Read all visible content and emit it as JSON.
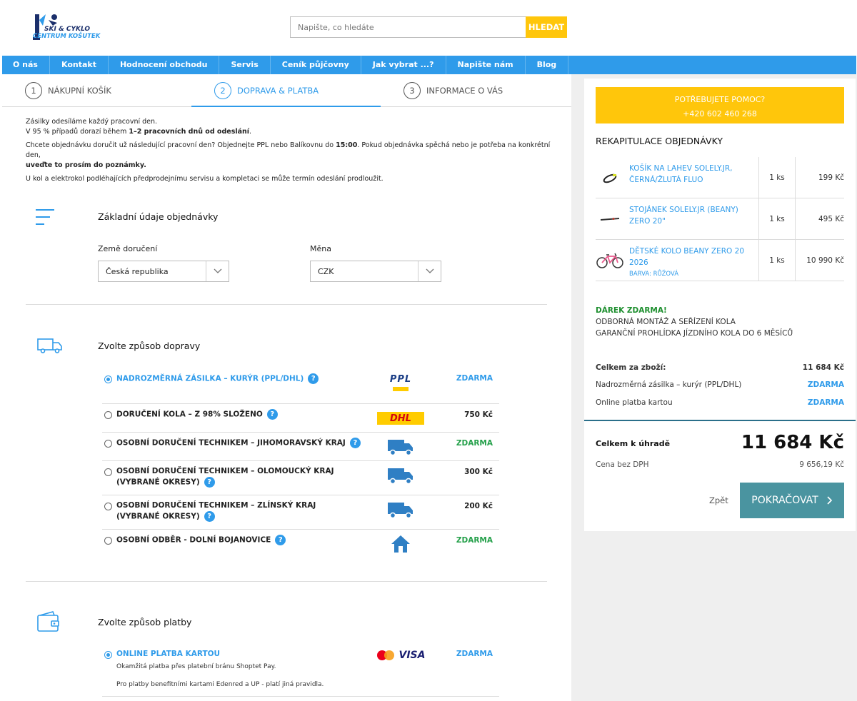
{
  "header": {
    "logo_text_1": "SKI & CYKLO",
    "logo_text_2": "CENTRUM KOŠUTEK",
    "search_placeholder": "Napište, co hledáte",
    "search_button": "HLEDAT"
  },
  "nav": [
    "O nás",
    "Kontakt",
    "Hodnocení obchodu",
    "Servis",
    "Ceník půjčovny",
    "Jak vybrat ...?",
    "Napište nám",
    "Blog"
  ],
  "steps": [
    {
      "num": "1",
      "label": "NÁKUPNÍ KOŠÍK"
    },
    {
      "num": "2",
      "label": "DOPRAVA & PLATBA"
    },
    {
      "num": "3",
      "label": "INFORMACE O VÁS"
    }
  ],
  "info": {
    "l1": "Zásilky odesíláme každý pracovní den.",
    "l2a": "V 95 % případů dorazí během ",
    "l2b": "1–2 pracovních dnů od odeslání",
    "l2c": ".",
    "l3a": "Chcete objednávku doručit už následující pracovní den? Objednejte PPL nebo Balíkovnu do ",
    "l3b": "15:00",
    "l3c": ". Pokud objednávka spěchá nebo je potřeba na konkrétní den,",
    "l3d": "uveďte to prosím do poznámky.",
    "l4": "U kol a elektrokol podléhajících předprodejnímu servisu a kompletaci se může termín odeslání prodloužit."
  },
  "basic": {
    "title": "Základní údaje objednávky",
    "country_label": "Země doručení",
    "country_value": "Česká republika",
    "currency_label": "Měna",
    "currency_value": "CZK"
  },
  "shipping": {
    "title": "Zvolte způsob dopravy",
    "options": [
      {
        "label": "NADROZMĚRNÁ ZÁSILKA – KURÝR (PPL/DHL)",
        "price": "ZDARMA"
      },
      {
        "label": "DORUČENÍ KOLA – Z 98% SLOŽENO",
        "price": "750 Kč"
      },
      {
        "label": "OSOBNÍ DORUČENÍ TECHNIKEM – JIHOMORAVSKÝ KRAJ",
        "price": "ZDARMA"
      },
      {
        "label": "OSOBNÍ DORUČENÍ TECHNIKEM – OLOMOUCKÝ KRAJ (VYBRANÉ OKRESY)",
        "price": "300 Kč"
      },
      {
        "label": "OSOBNÍ DORUČENÍ TECHNIKEM – ZLÍNSKÝ KRAJ (VYBRANÉ OKRESY)",
        "price": "200 Kč"
      },
      {
        "label": "OSOBNÍ ODBĚR - DOLNÍ BOJANOVICE",
        "price": "ZDARMA"
      }
    ],
    "ppl_text": "PPL",
    "dhl_text": "DHL"
  },
  "payment": {
    "title": "Zvolte způsob platby",
    "option_label": "ONLINE PLATBA KARTOU",
    "option_price": "ZDARMA",
    "desc1": "Okamžitá platba přes platební bránu Shoptet Pay.",
    "desc2": "Pro platby benefitními kartami Edenred a UP - platí jiná pravidla.",
    "visa_text": "VISA"
  },
  "sidebar": {
    "help_line1": "POTŘEBUJETE POMOC?",
    "help_line2": "+420 602 460 268",
    "recap_title": "REKAPITULACE OBJEDNÁVKY",
    "items": [
      {
        "name": "KOŠÍK NA LAHEV SOLELY.JR, ČERNÁ/ŽLUTÁ FLUO",
        "variant": "",
        "qty": "1 ks",
        "price": "199 Kč"
      },
      {
        "name": "STOJÁNEK SOLELY.JR (BEANY) ZERO 20\"",
        "variant": "",
        "qty": "1 ks",
        "price": "495 Kč"
      },
      {
        "name": "DĚTSKÉ KOLO BEANY ZERO 20 2026",
        "variant": "BARVA: RŮŽOVÁ",
        "qty": "1 ks",
        "price": "10 990 Kč"
      }
    ],
    "gift_title": "DÁREK ZDARMA!",
    "gift_line1": "ODBORNÁ MONTÁŽ A SEŘÍZENÍ KOLA",
    "gift_line2": "GARANČNÍ PROHLÍDKA JÍZDNÍHO KOLA DO 6 MĚSÍCŮ",
    "goods_label": "Celkem za zboží:",
    "goods_value": "11 684 Kč",
    "shipping_label": "Nadrozměrná zásilka – kurýr (PPL/DHL)",
    "shipping_value": "ZDARMA",
    "payment_label": "Online platba kartou",
    "payment_value": "ZDARMA",
    "total_label": "Celkem k úhradě",
    "total_value": "11 684 Kč",
    "novat_label": "Cena bez DPH",
    "novat_value": "9 656,19 Kč",
    "back_label": "Zpět",
    "continue_label": "POKRAČOVAT"
  },
  "colors": {
    "accent": "#2f9bea",
    "yellow": "#ffc60b",
    "green": "#24a04a",
    "continue": "#4a94a0"
  }
}
